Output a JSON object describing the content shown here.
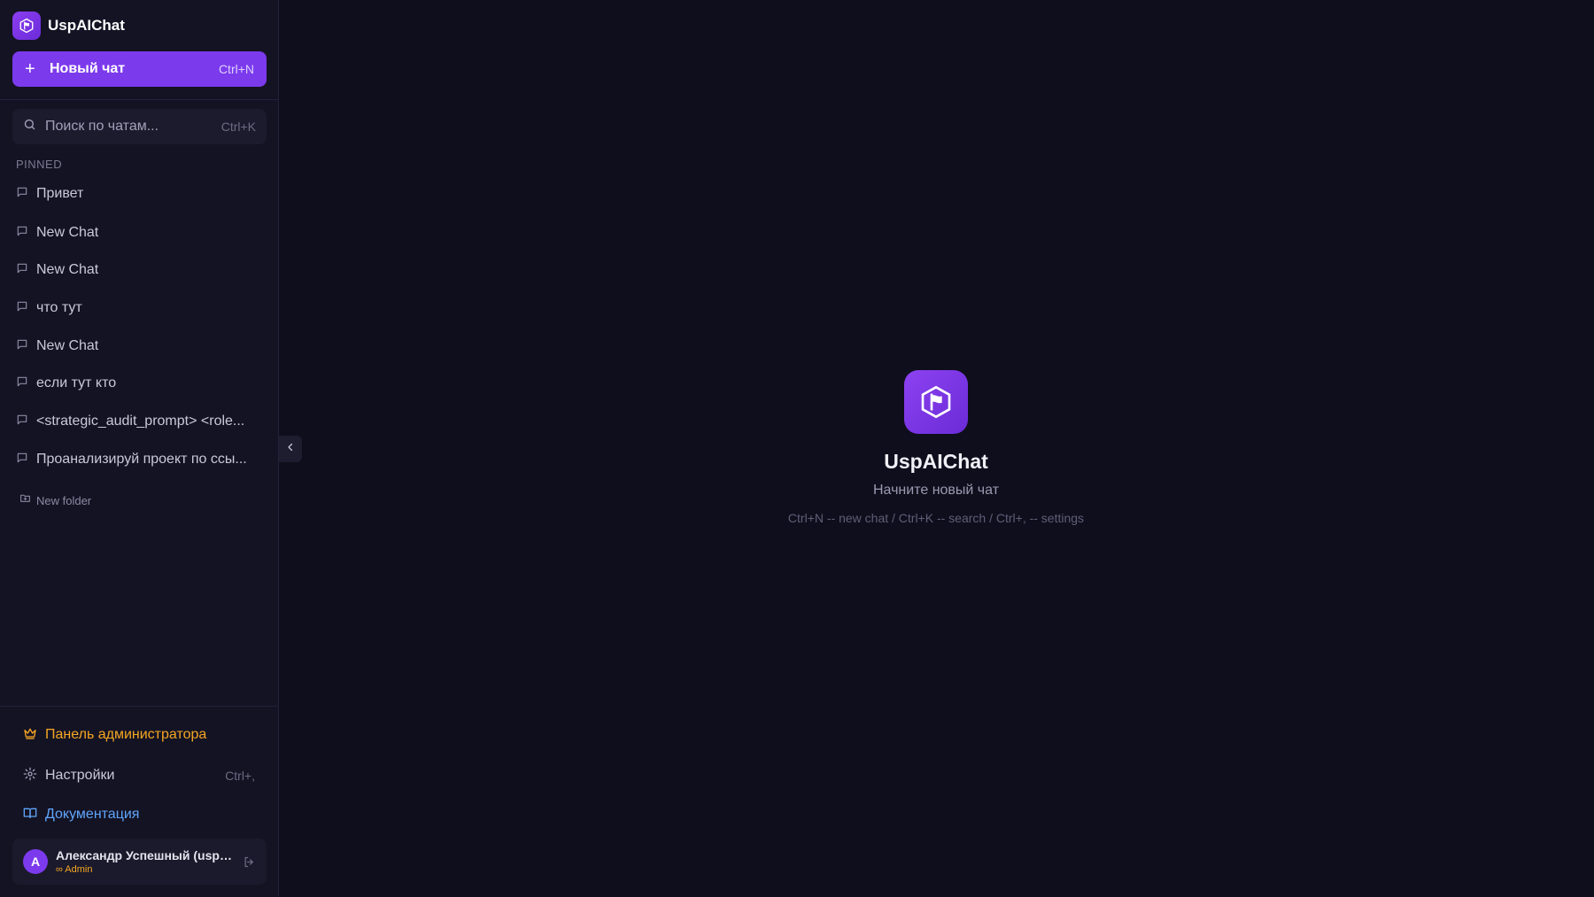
{
  "app": {
    "name": "UspAIChat"
  },
  "sidebar": {
    "new_chat_label": "Новый чат",
    "new_chat_shortcut": "Ctrl+N",
    "search": {
      "placeholder": "Поиск по чатам...",
      "shortcut": "Ctrl+K"
    },
    "pinned_label": "PINNED",
    "chats": [
      {
        "title": "Привет"
      },
      {
        "title": "New Chat"
      },
      {
        "title": "New Chat"
      },
      {
        "title": "что тут"
      },
      {
        "title": "New Chat"
      },
      {
        "title": "если тут кто"
      },
      {
        "title": "<strategic_audit_prompt> <role..."
      },
      {
        "title": "Проанализируй проект по ссы..."
      }
    ],
    "new_folder_label": "New folder",
    "admin_panel_label": "Панель администратора",
    "settings_label": "Настройки",
    "settings_shortcut": "Ctrl+,",
    "docs_label": "Документация",
    "user": {
      "initial": "А",
      "name": "Александр Успешный (uspe...",
      "role": "∞ Admin"
    }
  },
  "main": {
    "title": "UspAIChat",
    "subtitle": "Начните новый чат",
    "hint": "Ctrl+N -- new chat / Ctrl+K -- search / Ctrl+, -- settings"
  },
  "colors": {
    "accent": "#7c3aed",
    "admin": "#f5a623",
    "docs": "#60a5fa",
    "background": "#0f0e1c",
    "sidebar": "#141324"
  },
  "icons": {
    "brand": "flag-logo-icon",
    "new_chat": "plus-icon",
    "search": "search-icon",
    "chat": "message-square-icon",
    "folder": "folder-plus-icon",
    "admin": "crown-icon",
    "settings": "gear-icon",
    "docs": "book-open-icon",
    "logout": "logout-icon",
    "collapse": "chevron-left-icon"
  }
}
